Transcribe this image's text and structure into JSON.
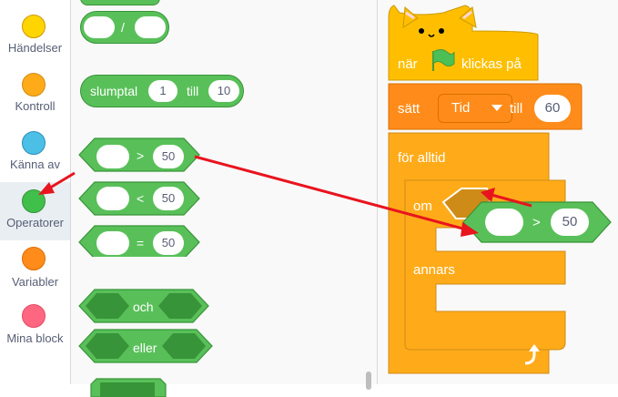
{
  "categories": [
    {
      "label": "Händelser",
      "color": "#ffd500"
    },
    {
      "label": "Kontroll",
      "color": "#ffab19"
    },
    {
      "label": "Känna av",
      "color": "#4cbfe6"
    },
    {
      "label": "Operatorer",
      "color": "#40bf4a"
    },
    {
      "label": "Variabler",
      "color": "#ff8c1a"
    },
    {
      "label": "Mina block",
      "color": "#ff6680"
    }
  ],
  "palette": {
    "divide_sign": "/",
    "random": {
      "label": "slumptal",
      "from": "1",
      "to_label": "till",
      "to": "10"
    },
    "gt": {
      "sign": ">",
      "value": "50"
    },
    "lt": {
      "sign": "<",
      "value": "50"
    },
    "eq": {
      "sign": "=",
      "value": "50"
    },
    "and_label": "och",
    "or_label": "eller"
  },
  "script": {
    "hat": {
      "label_before": "när",
      "label_after": "klickas på"
    },
    "set": {
      "label": "sätt",
      "variable": "Tid",
      "to_label": "till",
      "value": "60"
    },
    "forever_label": "för alltid",
    "if_label": "om",
    "else_label": "annars",
    "dragged": {
      "sign": ">",
      "value": "50"
    }
  },
  "colors": {
    "operator_green": "#59c059",
    "operator_dark": "#389438",
    "control": "#ffab19",
    "control_dark": "#cf8b17",
    "event": "#ffbf00",
    "variable": "#ff8c1a",
    "arrow_red": "#e8141e"
  }
}
